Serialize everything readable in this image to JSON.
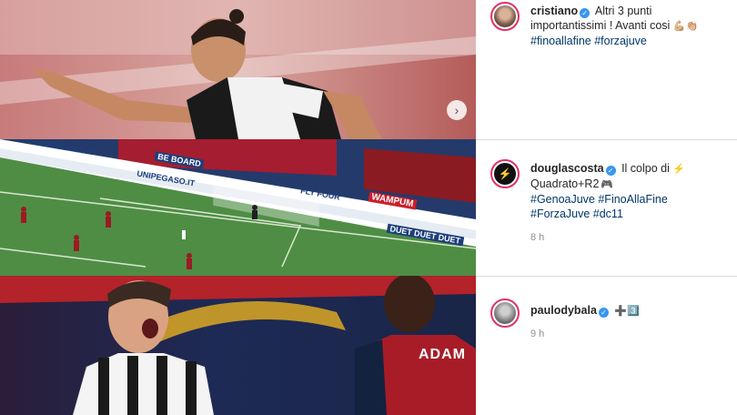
{
  "posts": [
    {
      "username": "cristiano",
      "caption": "Altri 3 punti importantissimi ! Avanti cosi",
      "emojis": "💪🏼👏🏼",
      "hashtags": "#finoallafine #forzajuve",
      "time": ""
    },
    {
      "username": "douglascosta",
      "caption": "Il colpo di",
      "caption_emoji": "⚡",
      "caption2": "Quadrato+R2",
      "caption2_emoji": "🎮",
      "hashtags": "#GenoaJuve #FinoAllaFine #ForzaJuve #dc11",
      "time": "8 h"
    },
    {
      "username": "paulodybala",
      "caption_emoji": "➕3️⃣",
      "time": "9 h"
    }
  ],
  "media": {
    "post2_ads": [
      "UNIPEGASO.IT",
      "BE BOARD",
      "UNIPEGASO.IT",
      "FLY FOUR",
      "WAMPUM",
      "DUET DUET DUET"
    ],
    "post3_jersey": "ADAM"
  },
  "icons": {
    "verified": "verified-badge-icon",
    "carousel_next": "chevron-right-icon"
  },
  "colors": {
    "accent_link": "#00376b",
    "verified": "#3897f0",
    "pitch_green": "#4f8d45",
    "genoa_red": "#b41b2a"
  }
}
